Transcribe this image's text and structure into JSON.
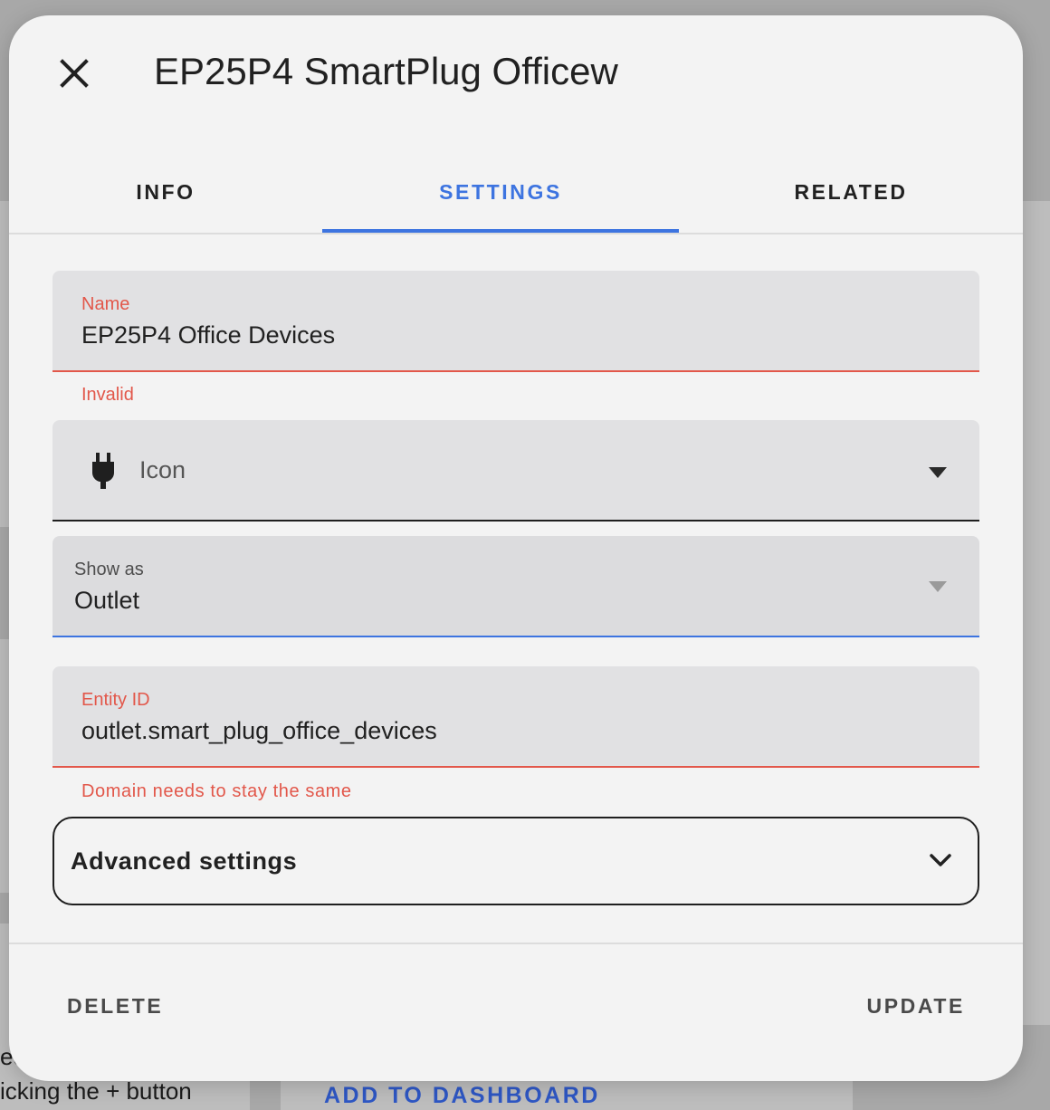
{
  "dialog": {
    "title": "EP25P4 SmartPlug Officew",
    "tabs": [
      {
        "label": "INFO",
        "active": false
      },
      {
        "label": "SETTINGS",
        "active": true
      },
      {
        "label": "RELATED",
        "active": false
      }
    ]
  },
  "form": {
    "name": {
      "label": "Name",
      "value": "EP25P4 Office Devices",
      "helper": "Invalid"
    },
    "icon": {
      "glyph": "power-plug-icon",
      "label": "Icon"
    },
    "show_as": {
      "label": "Show as",
      "value": "Outlet"
    },
    "entity_id": {
      "label": "Entity ID",
      "value": "outlet.smart_plug_office_devices",
      "helper": "Domain needs to stay the same"
    },
    "advanced": {
      "label": "Advanced settings"
    }
  },
  "footer": {
    "delete_label": "DELETE",
    "update_label": "UPDATE"
  },
  "background": {
    "left_line1": "ed",
    "left_line2": "icking the + button",
    "add_to_dashboard": "ADD TO DASHBOARD"
  },
  "colors": {
    "accent": "#3d74e0",
    "error": "#e2574a",
    "dialog_bg": "#f3f3f3",
    "field_bg": "#e1e1e3"
  }
}
